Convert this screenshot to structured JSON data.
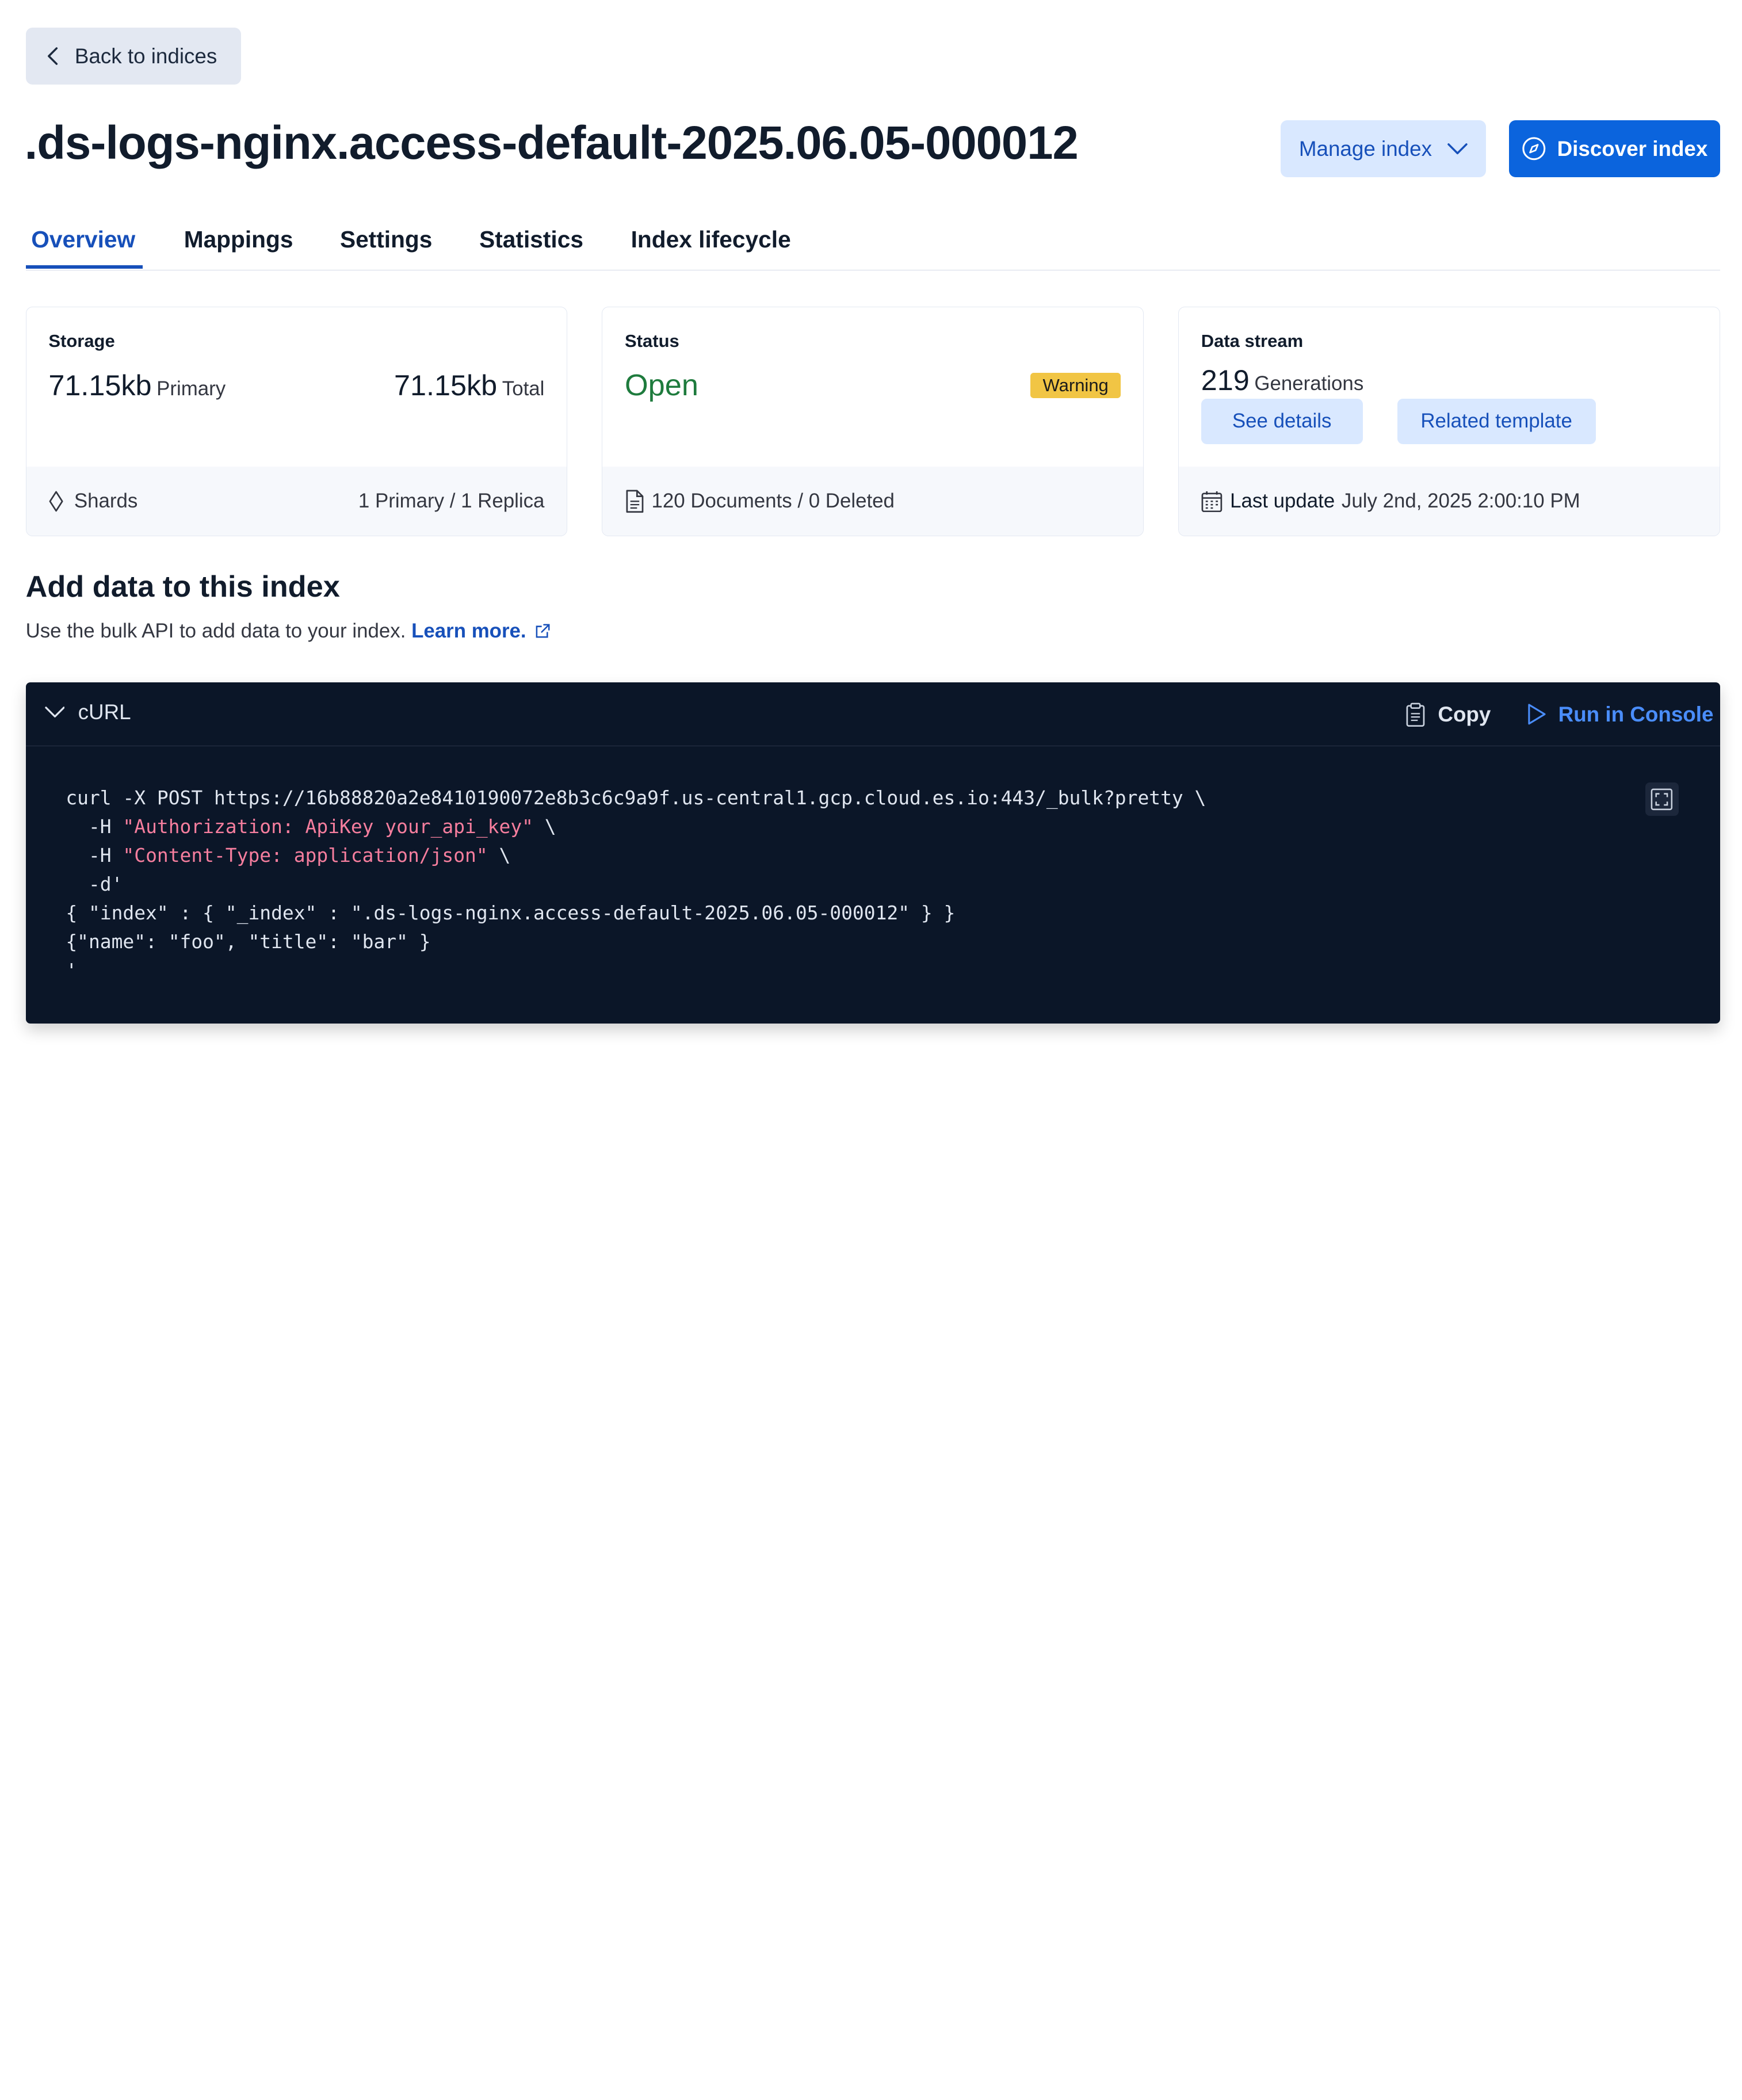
{
  "back_button": {
    "label": "Back to indices"
  },
  "title": ".ds-logs-nginx.access-default-2025.06.05-000012",
  "actions": {
    "manage_label": "Manage index",
    "discover_label": "Discover index"
  },
  "tabs": [
    {
      "label": "Overview",
      "active": true
    },
    {
      "label": "Mappings",
      "active": false
    },
    {
      "label": "Settings",
      "active": false
    },
    {
      "label": "Statistics",
      "active": false
    },
    {
      "label": "Index lifecycle",
      "active": false
    }
  ],
  "storage_card": {
    "label": "Storage",
    "primary_value": "71.15kb",
    "primary_unit": "Primary",
    "total_value": "71.15kb",
    "total_unit": "Total",
    "footer_label": "Shards",
    "footer_value": "1 Primary / 1 Replica"
  },
  "status_card": {
    "label": "Status",
    "value": "Open",
    "badge": "Warning",
    "footer": "120 Documents / 0 Deleted"
  },
  "datastream_card": {
    "label": "Data stream",
    "count": "219",
    "count_unit": "Generations",
    "see_details": "See details",
    "related_template": "Related template",
    "footer_label": "Last update",
    "footer_value": "July 2nd, 2025 2:00:10 PM"
  },
  "add_data": {
    "title": "Add data to this index",
    "description": "Use the bulk API to add data to your index.",
    "learn_more": "Learn more."
  },
  "code_panel": {
    "language": "cURL",
    "copy_label": "Copy",
    "run_label": "Run in Console",
    "lines": {
      "l1": "curl -X POST https://16b88820a2e8410190072e8b3c6c9a9f.us-central1.gcp.cloud.es.io:443/_bulk?pretty \\",
      "l2_prefix": "  -H ",
      "l2_str": "\"Authorization: ApiKey your_api_key\"",
      "l2_suffix": " \\",
      "l3_prefix": "  -H ",
      "l3_str": "\"Content-Type: application/json\"",
      "l3_suffix": " \\",
      "l4": "  -d'",
      "l5": "{ \"index\" : { \"_index\" : \".ds-logs-nginx.access-default-2025.06.05-000012\" } }",
      "l6": "{\"name\": \"foo\", \"title\": \"bar\" }",
      "l7": "'"
    }
  },
  "colors": {
    "primary": "#0b64dd",
    "link": "#1750ba",
    "status_open": "#1e7b3d",
    "warning_badge": "#f1c544",
    "code_bg": "#0b1628",
    "code_string": "#f67e9e"
  }
}
